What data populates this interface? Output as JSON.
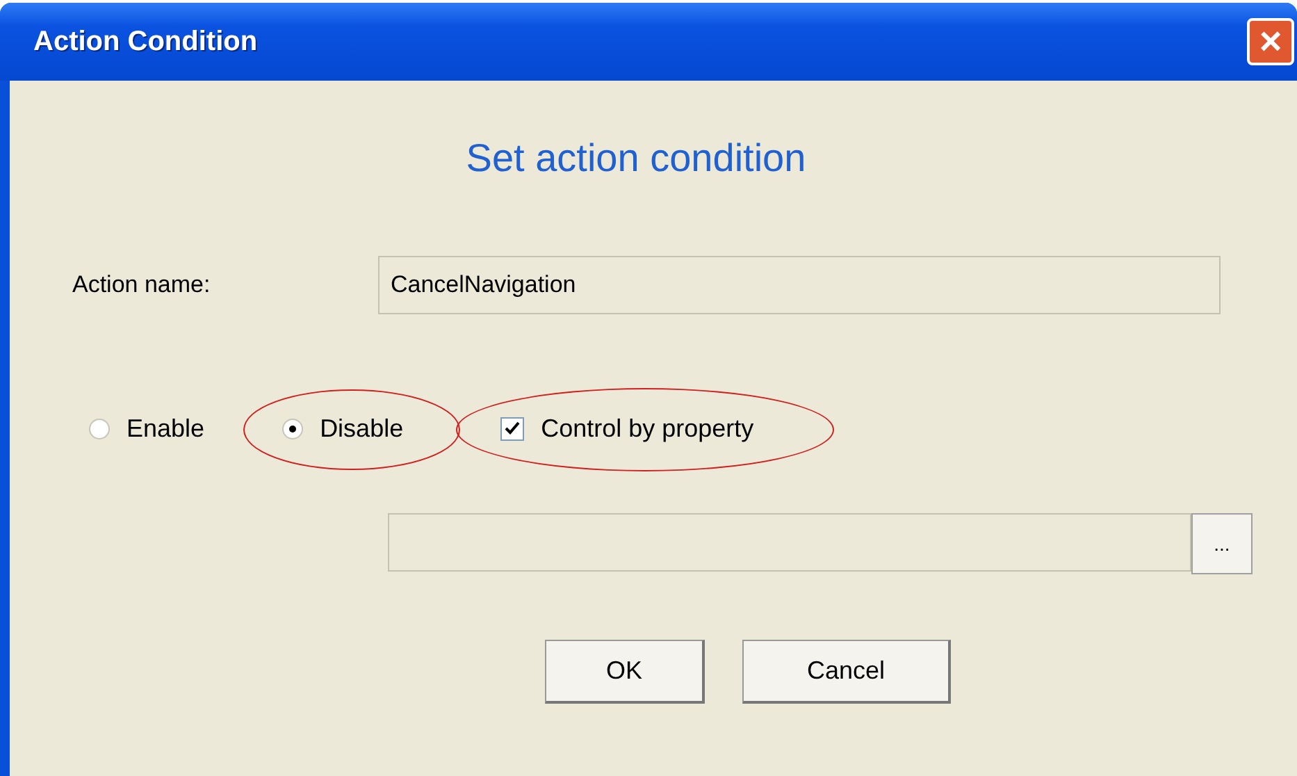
{
  "window": {
    "title": "Action Condition",
    "close_icon": "×"
  },
  "heading": "Set action condition",
  "action_name": {
    "label": "Action name:",
    "value": "CancelNavigation"
  },
  "options": [
    {
      "label": "Enable",
      "selected": false,
      "annotated": false
    },
    {
      "label": "Disable",
      "selected": true,
      "annotated": true
    }
  ],
  "control_by_property": {
    "label": "Control by property",
    "checked": true,
    "annotated": true
  },
  "property_field": {
    "browse_label": "..."
  },
  "buttons": [
    "OK",
    "Cancel"
  ]
}
